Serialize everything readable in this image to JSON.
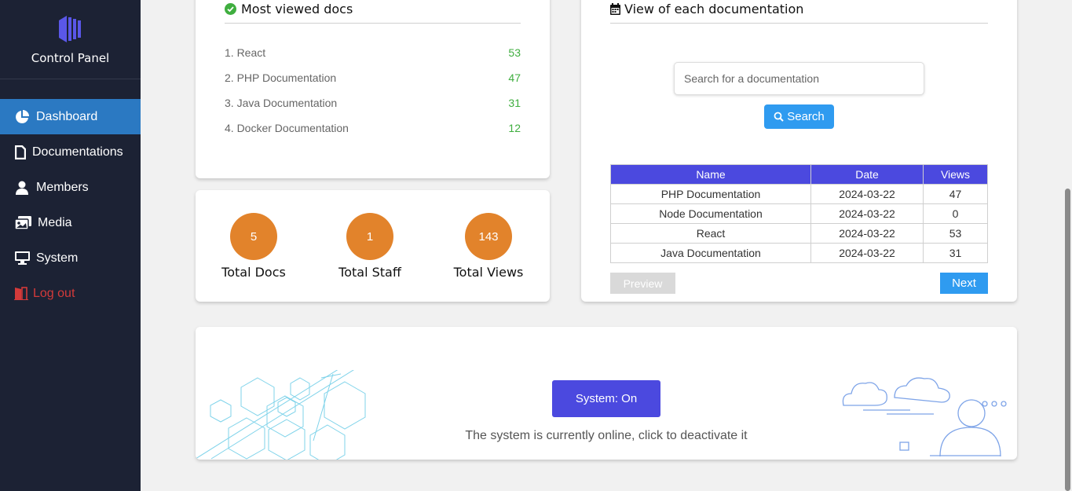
{
  "sidebar": {
    "brand": "Control Panel",
    "items": [
      {
        "label": "Dashboard",
        "icon": "pie-chart-icon",
        "active": true
      },
      {
        "label": "Documentations",
        "icon": "file-icon"
      },
      {
        "label": "Members",
        "icon": "user-icon"
      },
      {
        "label": "Media",
        "icon": "images-icon"
      },
      {
        "label": "System",
        "icon": "monitor-icon"
      },
      {
        "label": "Log out",
        "icon": "door-icon",
        "color": "#d33a3a"
      }
    ]
  },
  "most_viewed": {
    "title": "Most viewed docs",
    "items": [
      {
        "name": "1. React",
        "count": "53"
      },
      {
        "name": "2. PHP Documentation",
        "count": "47"
      },
      {
        "name": "3. Java Documentation",
        "count": "31"
      },
      {
        "name": "4. Docker Documentation",
        "count": "12"
      }
    ]
  },
  "stats": [
    {
      "value": "5",
      "label": "Total Docs"
    },
    {
      "value": "1",
      "label": "Total Staff"
    },
    {
      "value": "143",
      "label": "Total Views"
    }
  ],
  "docs_view": {
    "title": "View of each documentation",
    "search_placeholder": "Search for a documentation",
    "search_label": "Search",
    "columns": [
      "Name",
      "Date",
      "Views"
    ],
    "rows": [
      [
        "PHP Documentation",
        "2024-03-22",
        "47"
      ],
      [
        "Node Documentation",
        "2024-03-22",
        "0"
      ],
      [
        "React",
        "2024-03-22",
        "53"
      ],
      [
        "Java Documentation",
        "2024-03-22",
        "31"
      ]
    ],
    "prev_label": "Preview",
    "next_label": "Next"
  },
  "system": {
    "button_label": "System: On",
    "status_text": "The system is currently online, click to deactivate it"
  },
  "colors": {
    "sidebar_bg": "#1c2234",
    "active_nav": "#2b79c2",
    "accent_purple": "#4b49df",
    "stat_orange": "#e2832b",
    "count_green": "#3fae3f",
    "button_blue": "#2f9bf0",
    "logout_red": "#d33a3a"
  }
}
